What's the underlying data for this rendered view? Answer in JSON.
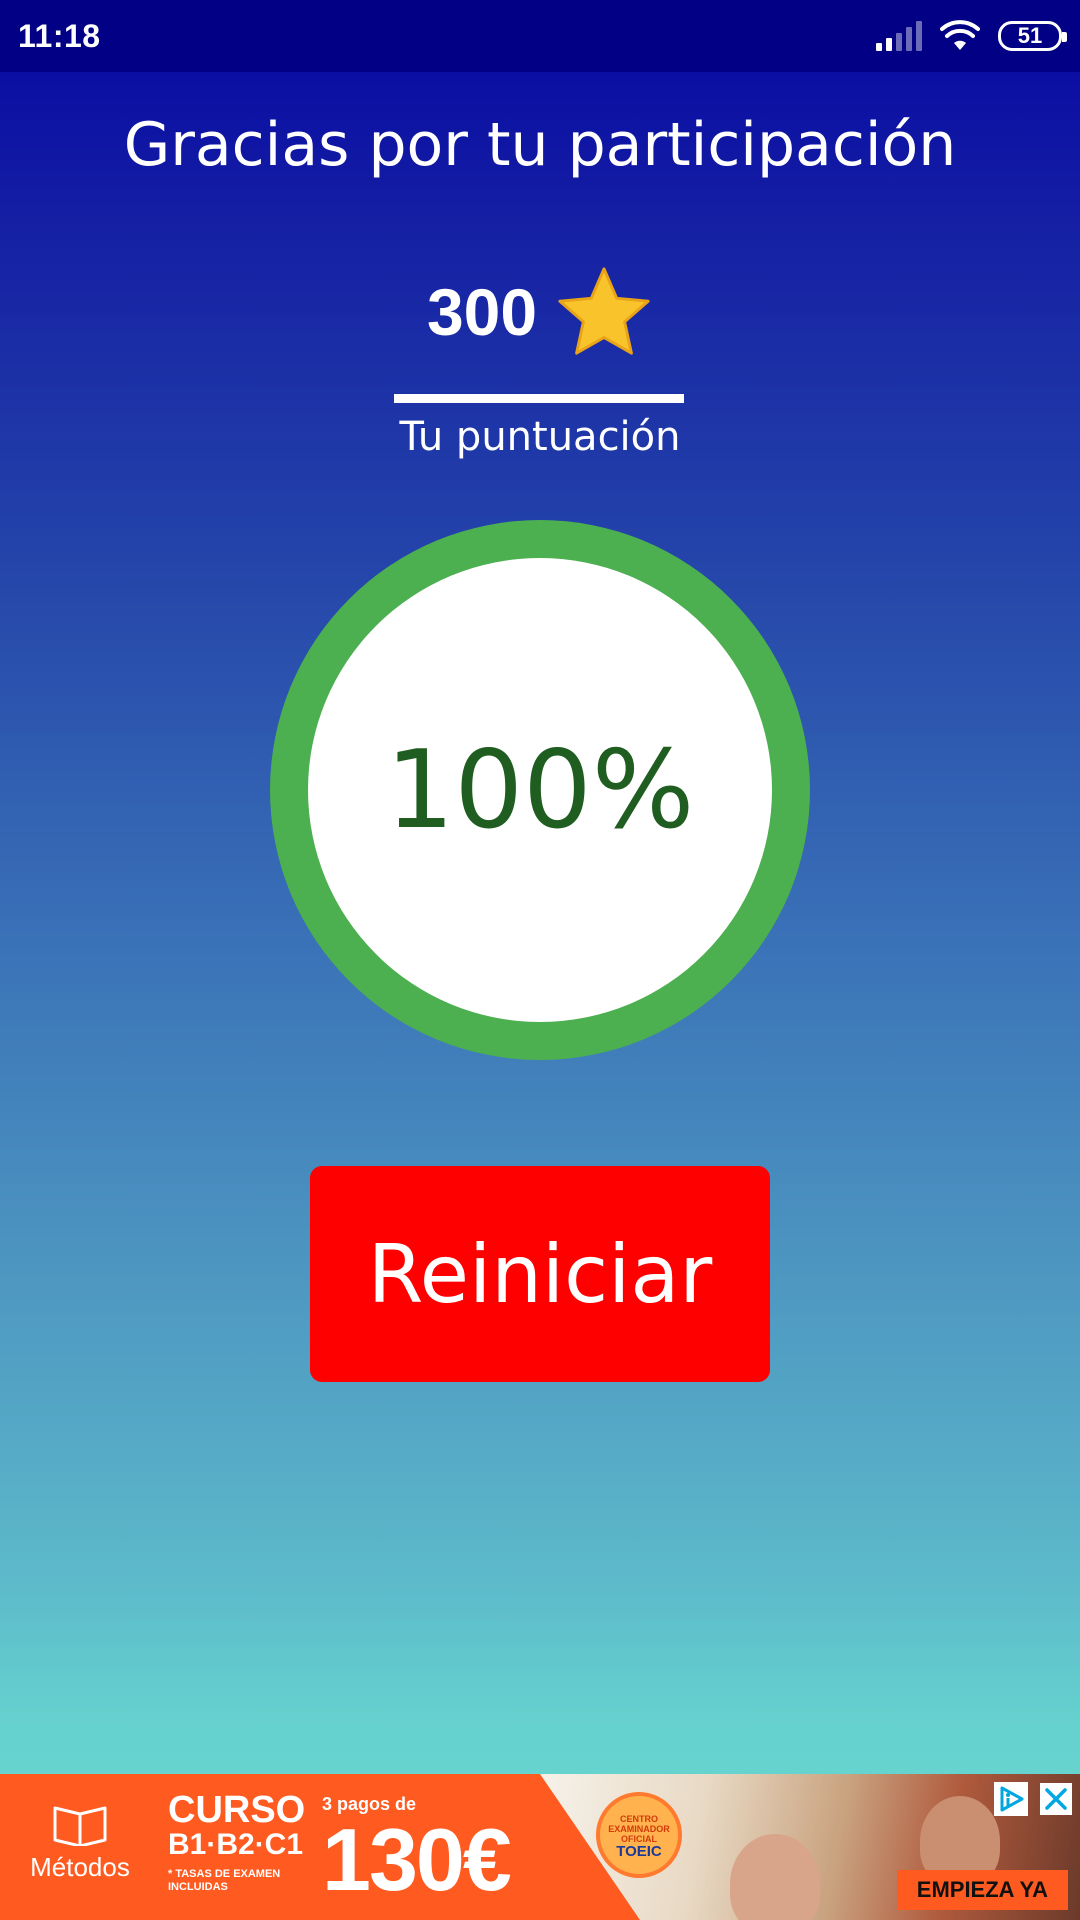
{
  "status_bar": {
    "time": "11:18",
    "battery": "51"
  },
  "main": {
    "title": "Gracias por tu participación",
    "score_value": "300",
    "score_label": "Tu puntuación",
    "percentage_text": "100%",
    "percentage": 100,
    "restart_label": "Reiniciar"
  },
  "ad": {
    "brand": "Métodos",
    "course_title": "CURSO",
    "course_levels": "B1·B2·C1",
    "course_note": "* TASAS DE EXAMEN INCLUIDAS",
    "price_top": "3 pagos de",
    "price_value": "130€",
    "seal_text": "CENTRO EXAMINADOR OFICIAL",
    "seal_brand": "TOEIC",
    "cta": "EMPIEZA YA"
  },
  "colors": {
    "status_bar": "#020185",
    "gradient_top": "#0606a2",
    "gradient_bottom": "#6ad6d0",
    "ring": "#4caf50",
    "percentage_text": "#1f5e20",
    "restart_button": "#ff0000",
    "star": "#f9c42b",
    "ad_background": "#ff5a1f"
  },
  "icons": {
    "star": "star-icon",
    "wifi": "wifi-icon",
    "signal": "signal-icon",
    "battery": "battery-icon",
    "ad_choices": "adchoices-icon",
    "close": "close-icon",
    "book": "book-icon"
  }
}
